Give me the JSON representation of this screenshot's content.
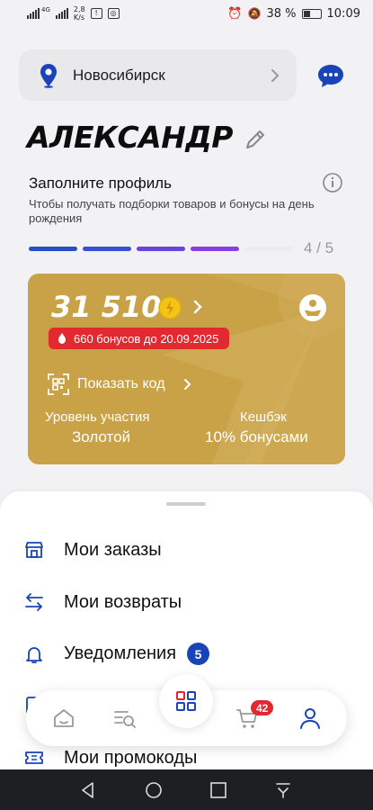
{
  "status_bar": {
    "network_type": "4G",
    "speed_value": "2,8",
    "speed_unit": "K/s",
    "battery_percent": "38 %",
    "time": "10:09"
  },
  "header": {
    "city": "Новосибирск"
  },
  "profile": {
    "name": "АЛЕКСАНДР",
    "fill_title": "Заполните профиль",
    "fill_subtitle": "Чтобы получать подборки товаров и бонусы на день рождения",
    "progress_steps_done": 4,
    "progress_steps_total": 5,
    "progress_label": "4 / 5",
    "progress_colors": [
      "#2a4fc0",
      "#3a51cf",
      "#6a45d8",
      "#8a3fe0",
      "#ececef"
    ]
  },
  "bonus_card": {
    "points": "31 510",
    "expiring": "660 бонусов до 20.09.2025",
    "show_code": "Показать код",
    "level_label": "Уровень участия",
    "level_value": "Золотой",
    "cashback_label": "Кешбэк",
    "cashback_value": "10% бонусами",
    "card_color": "#c9a247"
  },
  "menu": {
    "items": [
      {
        "label": "Мои заказы",
        "icon": "shop-box-icon"
      },
      {
        "label": "Мои возвраты",
        "icon": "return-arrow-icon"
      },
      {
        "label": "Уведомления",
        "icon": "bell-icon",
        "badge": "5"
      },
      {
        "label": "",
        "icon": "doc-icon"
      },
      {
        "label": "Мои промокоды",
        "icon": "ticket-icon"
      }
    ]
  },
  "bottom_nav": {
    "cart_badge": "42",
    "active": "profile",
    "accent_color": "#1944b8"
  }
}
